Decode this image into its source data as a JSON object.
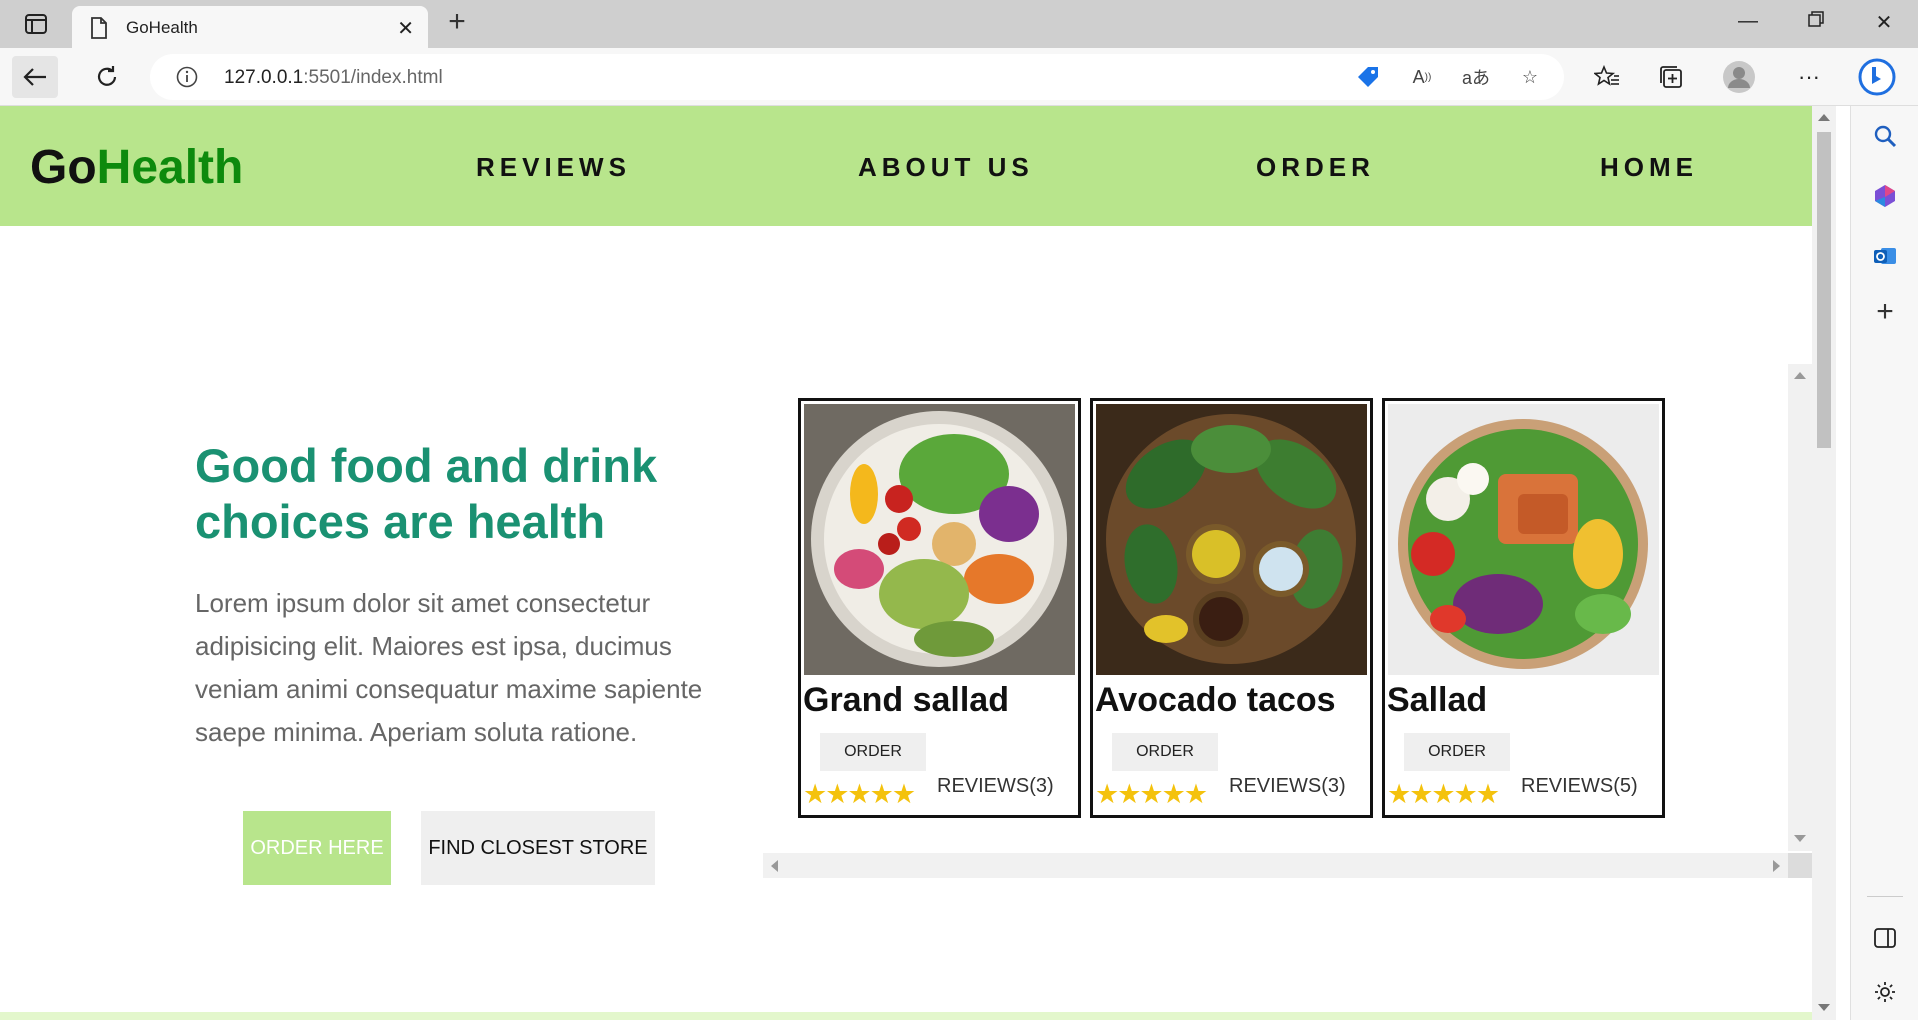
{
  "browser": {
    "tab_title": "GoHealth",
    "url_host": "127.0.0.1",
    "url_path": ":5501/index.html"
  },
  "site": {
    "logo_go": "Go",
    "logo_health": "Health",
    "nav": [
      "REVIEWS",
      "ABOUT US",
      "ORDER",
      "HOME"
    ],
    "hero_title": "Good food and drink choices are health",
    "hero_text": "Lorem ipsum dolor sit amet consectetur adipisicing elit. Maiores est ipsa, ducimus veniam animi consequatur maxime sapiente saepe minima. Aperiam soluta ratione.",
    "order_here": "ORDER HERE",
    "find_store": "FIND CLOSEST STORE",
    "cards": [
      {
        "name": "Grand sallad",
        "order": "ORDER",
        "stars": "★★★★★",
        "reviews": "REVIEWS(3)"
      },
      {
        "name": "Avocado tacos",
        "order": "ORDER",
        "stars": "★★★★★",
        "reviews": "REVIEWS(3)"
      },
      {
        "name": "Sallad",
        "order": "ORDER",
        "stars": "★★★★★",
        "reviews": "REVIEWS(5)"
      }
    ]
  },
  "colors": {
    "header_green": "#b8e58c",
    "logo_green": "#0d8a0d",
    "hero_title": "#1a9172",
    "stars": "#f4c20d"
  }
}
